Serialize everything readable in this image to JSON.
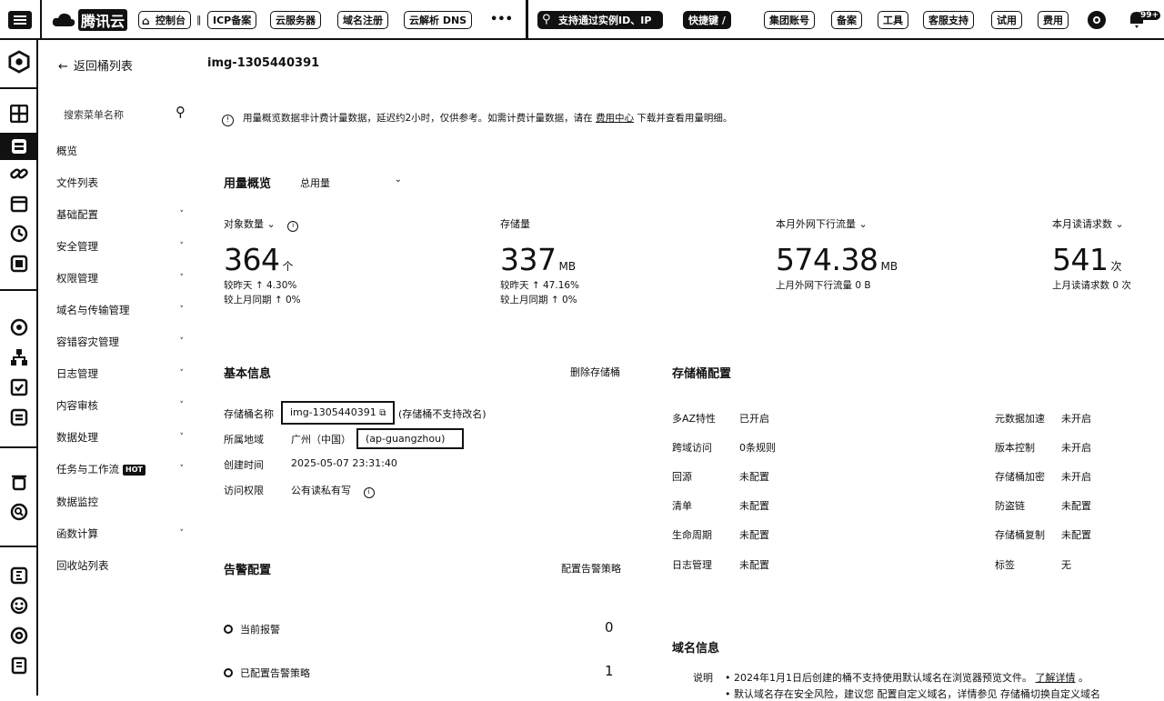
{
  "topbar": {
    "brand": "腾讯云",
    "console": "控制台",
    "nav": [
      "ICP备案",
      "云服务器",
      "域名注册",
      "云解析 DNS"
    ],
    "more": "•••",
    "search_placeholder": "支持通过实例ID、IP",
    "shortcut": "快捷键 /",
    "right": [
      "集团账号",
      "备案",
      "工具",
      "客服支持",
      "试用",
      "费用"
    ],
    "badge": "99+"
  },
  "menu": {
    "back": "返回桶列表",
    "search_placeholder": "搜索菜单名称",
    "items": [
      {
        "label": "概览",
        "chevron": ""
      },
      {
        "label": "文件列表",
        "chevron": ""
      },
      {
        "label": "基础配置",
        "chevron": "˅"
      },
      {
        "label": "安全管理",
        "chevron": "˅"
      },
      {
        "label": "权限管理",
        "chevron": "˅"
      },
      {
        "label": "域名与传输管理",
        "chevron": "˅"
      },
      {
        "label": "容错容灾管理",
        "chevron": "˅"
      },
      {
        "label": "日志管理",
        "chevron": "˅"
      },
      {
        "label": "内容审核",
        "chevron": "˅"
      },
      {
        "label": "数据处理",
        "chevron": "˅"
      },
      {
        "label": "任务与工作流",
        "chevron": "˅",
        "badge": "HOT"
      },
      {
        "label": "数据监控",
        "chevron": ""
      },
      {
        "label": "函数计算",
        "chevron": "˅"
      },
      {
        "label": "回收站列表",
        "chevron": ""
      }
    ]
  },
  "main": {
    "bucket_title": "img-1305440391",
    "notice": {
      "text": "用量概览数据非计费计量数据，延迟约2小时，仅供参考。如需计费计量数据，请在",
      "link": "费用中心",
      "tail": "下载并查看用量明细。"
    },
    "usage": {
      "title": "用量概览",
      "select": "总用量",
      "stats": [
        {
          "label": "对象数量",
          "value": "364",
          "unit": "个",
          "line1_label": "较昨天",
          "line1_value": "4.30%",
          "line2_label": "较上月同期",
          "line2_value": "0%"
        },
        {
          "label": "存储量",
          "value": "337",
          "unit": "MB",
          "line1_label": "较昨天",
          "line1_value": "47.16%",
          "line2_label": "较上月同期",
          "line2_value": "0%"
        },
        {
          "label": "本月外网下行流量",
          "value": "574.38",
          "unit": "MB",
          "line1_label": "上月外网下行流量",
          "line1_value": "0 B"
        },
        {
          "label": "本月读请求数",
          "value": "541",
          "unit": "次",
          "line1_label": "上月读请求数",
          "line1_value": "0 次"
        }
      ]
    },
    "basic": {
      "title": "基本信息",
      "delete": "删除存储桶",
      "name_label": "存储桶名称",
      "name_value": "img-1305440391",
      "name_note": "(存储桶不支持改名)",
      "region_label": "所属地域",
      "region_value": "广州（中国）",
      "region_code": "(ap-guangzhou)",
      "created_label": "创建时间",
      "created_value": "2025-05-07 23:31:40",
      "access_label": "访问权限",
      "access_value": "公有读私有写"
    },
    "alarm": {
      "title": "告警配置",
      "config": "配置告警策略",
      "current_label": "当前报警",
      "current_value": "0",
      "configured_label": "已配置告警策略",
      "configured_value": "1"
    },
    "storage": {
      "title": "存储桶配置",
      "left": [
        {
          "k": "多AZ特性",
          "v": "已开启"
        },
        {
          "k": "跨域访问",
          "v": "0条规则"
        },
        {
          "k": "回源",
          "v": "未配置"
        },
        {
          "k": "清单",
          "v": "未配置"
        },
        {
          "k": "生命周期",
          "v": "未配置"
        },
        {
          "k": "日志管理",
          "v": "未配置"
        }
      ],
      "right": [
        {
          "k": "元数据加速",
          "v": "未开启"
        },
        {
          "k": "版本控制",
          "v": "未开启"
        },
        {
          "k": "存储桶加密",
          "v": "未开启"
        },
        {
          "k": "防盗链",
          "v": "未配置"
        },
        {
          "k": "存储桶复制",
          "v": "未配置"
        },
        {
          "k": "标签",
          "v": "无"
        }
      ]
    },
    "domain": {
      "title": "域名信息",
      "label": "说明",
      "note1": "2024年1月1日后创建的桶不支持使用默认域名在浏览器预览文件。",
      "note1_link": "了解详情",
      "note2": "默认域名存在安全风险，建议您 配置自定义域名，详情参见 存储桶切换自定义域名"
    }
  }
}
